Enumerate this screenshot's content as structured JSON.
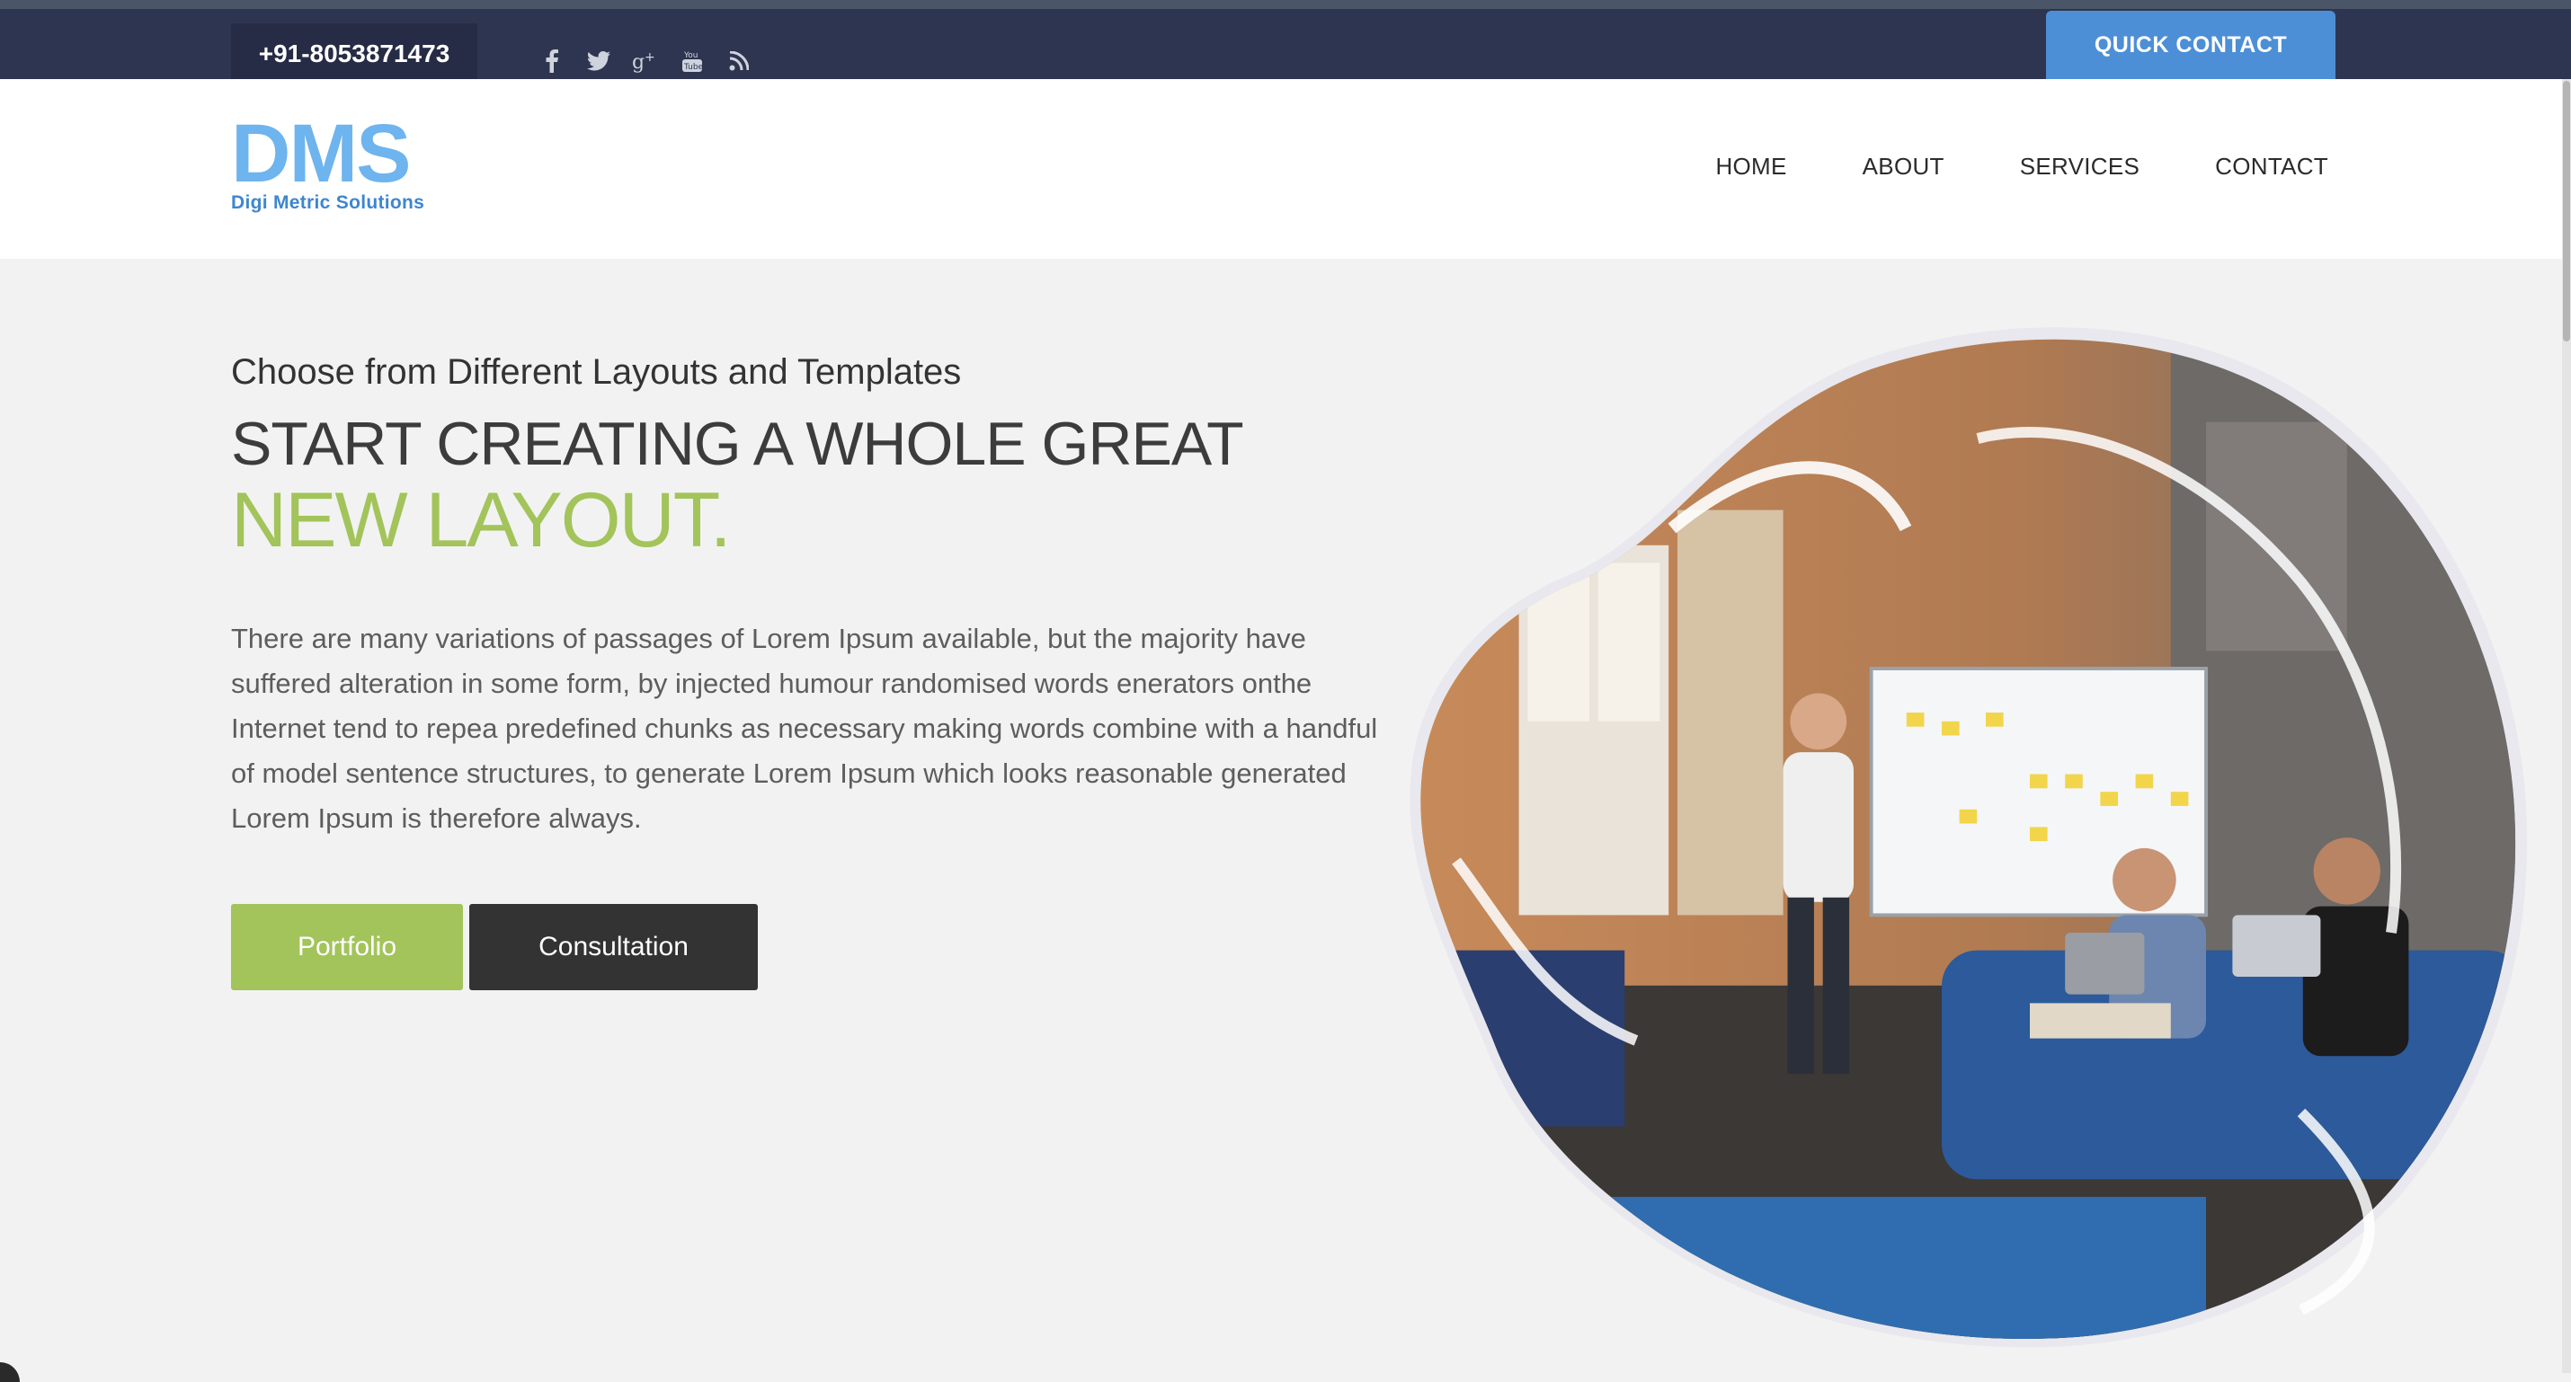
{
  "topbar": {
    "phone": "+91-8053871473",
    "social_icons": [
      "facebook-icon",
      "twitter-icon",
      "google-plus-icon",
      "youtube-icon",
      "rss-icon"
    ],
    "quick_contact": "QUICK CONTACT"
  },
  "header": {
    "logo_mark": "DMS",
    "logo_sub": "Digi Metric Solutions",
    "nav": [
      "HOME",
      "ABOUT",
      "SERVICES",
      "CONTACT"
    ]
  },
  "hero": {
    "subtitle": "Choose from Different Layouts and Templates",
    "title_line1": "START CREATING A WHOLE GREAT",
    "title_line2": "NEW LAYOUT.",
    "paragraph": "There are many variations of passages of Lorem Ipsum available, but the majority have suffered alteration in some form, by injected humour randomised words enerators onthe Internet tend to repea predefined chunks as necessary making words combine with a handful of model sentence structures, to generate Lorem Ipsum which looks reasonable generated Lorem Ipsum is therefore always.",
    "btn_portfolio": "Portfolio",
    "btn_consultation": "Consultation"
  },
  "colors": {
    "topbar": "#2e3550",
    "accent_blue": "#4d8fd6",
    "accent_green": "#a2c45a",
    "dark_button": "#333333"
  }
}
